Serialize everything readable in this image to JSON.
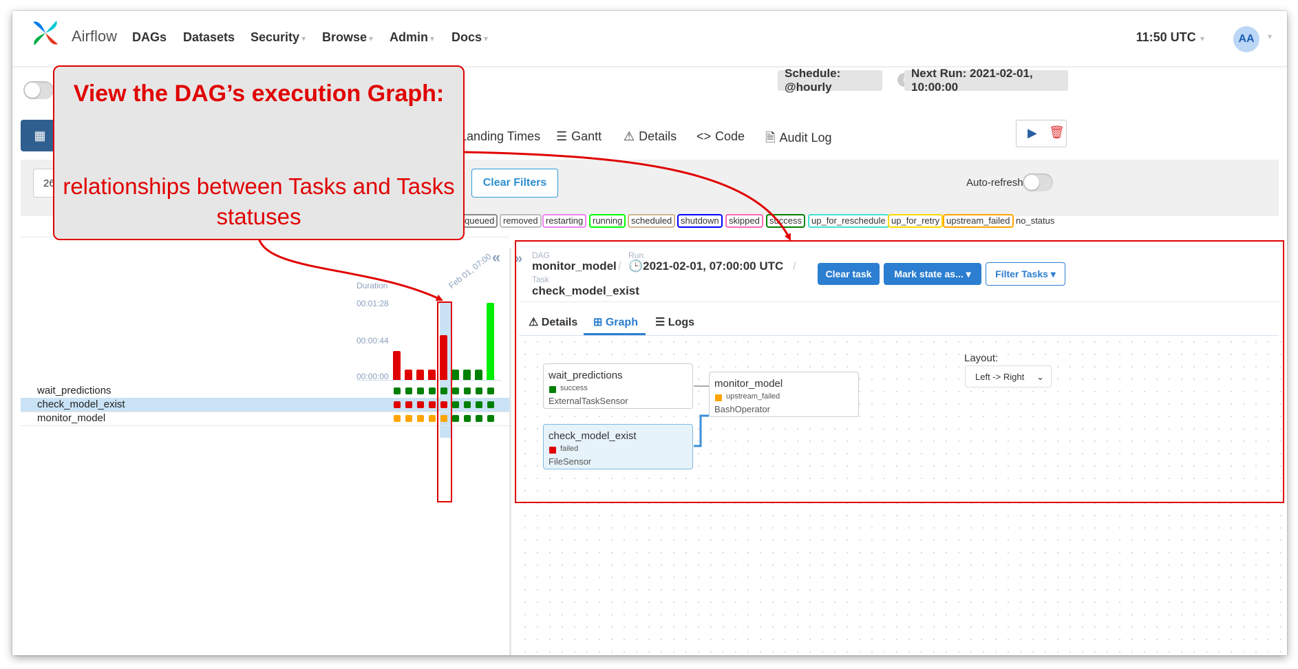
{
  "navbar": {
    "logo_text": "Airflow",
    "items": [
      {
        "label": "DAGs",
        "dropdown": false
      },
      {
        "label": "Datasets",
        "dropdown": false
      },
      {
        "label": "Security",
        "dropdown": true
      },
      {
        "label": "Browse",
        "dropdown": true
      },
      {
        "label": "Admin",
        "dropdown": true
      },
      {
        "label": "Docs",
        "dropdown": true
      }
    ],
    "clock": "11:50 UTC",
    "avatar_initials": "AA"
  },
  "header": {
    "schedule": "Schedule: @hourly",
    "next_run": "Next Run: 2021-02-01, 10:00:00"
  },
  "views": {
    "landing_times": "Landing Times",
    "gantt": "Gantt",
    "details": "Details",
    "code": "Code",
    "audit_log": "Audit Log"
  },
  "filters": {
    "date_value": "26",
    "clear_filters": "Clear Filters",
    "auto_refresh": "Auto-refresh"
  },
  "legend": [
    "queued",
    "removed",
    "restarting",
    "running",
    "scheduled",
    "shutdown",
    "skipped",
    "success",
    "up_for_reschedule",
    "up_for_retry",
    "upstream_failed",
    "no_status"
  ],
  "legend_colors": {
    "queued": "#888888",
    "removed": "#bbbbbb",
    "restarting": "#ee82ee",
    "running": "#00ff00",
    "scheduled": "#d2b48c",
    "shutdown": "#0000ff",
    "skipped": "#ff69b4",
    "success": "#008000",
    "up_for_reschedule": "#40e0d0",
    "up_for_retry": "#ffd700",
    "upstream_failed": "#ffa500"
  },
  "grid": {
    "duration_label": "Duration",
    "duration_ticks": [
      "00:01:28",
      "00:00:44",
      "00:00:00"
    ],
    "date_column_label": "Feb 01, 07:00",
    "run_durations_sec": [
      33,
      12,
      12,
      12,
      51,
      12,
      12,
      12,
      100
    ],
    "run_bar_colors": [
      "#e00000",
      "#e00000",
      "#e00000",
      "#e00000",
      "#e00000",
      "#008000",
      "#008000",
      "#008000",
      "#00ee00"
    ],
    "selected_run_index": 4,
    "tasks": [
      {
        "name": "wait_predictions",
        "statuses": [
          "success",
          "success",
          "success",
          "success",
          "success",
          "success",
          "success",
          "success",
          "success"
        ]
      },
      {
        "name": "check_model_exist",
        "statuses": [
          "failed",
          "failed",
          "failed",
          "failed",
          "failed",
          "success",
          "success",
          "success",
          "success"
        ]
      },
      {
        "name": "monitor_model",
        "statuses": [
          "upstream_failed",
          "upstream_failed",
          "upstream_failed",
          "upstream_failed",
          "upstream_failed",
          "success",
          "success",
          "success",
          "success"
        ]
      }
    ],
    "status_colors": {
      "success": "#008000",
      "failed": "#e00000",
      "upstream_failed": "#ffa500"
    }
  },
  "details_panel": {
    "dag_caption": "DAG",
    "dag_name": "monitor_model",
    "run_caption": "Run",
    "run_value": "2021-02-01, 07:00:00 UTC",
    "task_caption": "Task",
    "task_name": "check_model_exist",
    "clear_task": "Clear task",
    "mark_state": "Mark state as...",
    "filter_tasks": "Filter Tasks",
    "tabs": {
      "details": "Details",
      "graph": "Graph",
      "logs": "Logs"
    },
    "layout_label": "Layout:",
    "layout_value": "Left -> Right"
  },
  "graph": {
    "nodes": [
      {
        "name": "wait_predictions",
        "status": "success",
        "operator": "ExternalTaskSensor",
        "status_color": "#008000"
      },
      {
        "name": "check_model_exist",
        "status": "failed",
        "operator": "FileSensor",
        "status_color": "#e00000"
      },
      {
        "name": "monitor_model",
        "status": "upstream_failed",
        "operator": "BashOperator",
        "status_color": "#ffa500"
      }
    ]
  },
  "annotation": {
    "title": "View the DAG’s execution Graph:",
    "text": "relationships between Tasks and Tasks statuses",
    "color": "#e00000"
  }
}
